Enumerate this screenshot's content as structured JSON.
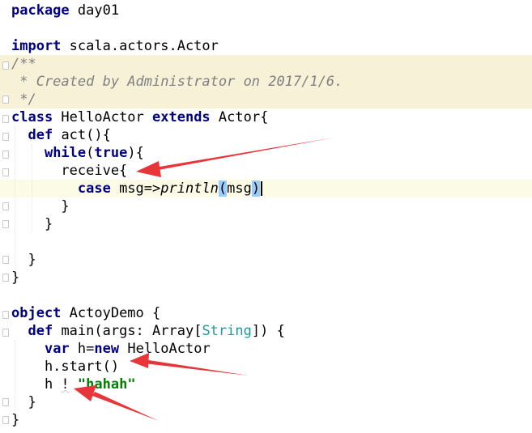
{
  "code_lines": [
    {
      "id": "l1",
      "segs": [
        {
          "t": "package",
          "c": "kw"
        },
        {
          "t": " day01"
        }
      ]
    },
    {
      "id": "l2",
      "segs": []
    },
    {
      "id": "l3",
      "segs": [
        {
          "t": "import",
          "c": "kw"
        },
        {
          "t": " scala.actors.Actor"
        }
      ]
    },
    {
      "id": "l4",
      "segs": [
        {
          "t": "/**",
          "c": "cm"
        }
      ]
    },
    {
      "id": "l5",
      "segs": [
        {
          "t": " * Created by Administrator on 2017/1/6.",
          "c": "cm"
        }
      ]
    },
    {
      "id": "l6",
      "segs": [
        {
          "t": " */",
          "c": "cm"
        }
      ]
    },
    {
      "id": "l7",
      "segs": [
        {
          "t": "class",
          "c": "kw"
        },
        {
          "t": " HelloActor "
        },
        {
          "t": "extends",
          "c": "kw"
        },
        {
          "t": " Actor{"
        }
      ]
    },
    {
      "id": "l8",
      "segs": [
        {
          "t": "  "
        },
        {
          "t": "def",
          "c": "kw"
        },
        {
          "t": " act(){"
        }
      ]
    },
    {
      "id": "l9",
      "segs": [
        {
          "t": "    "
        },
        {
          "t": "while",
          "c": "kw"
        },
        {
          "t": "("
        },
        {
          "t": "true",
          "c": "kw"
        },
        {
          "t": "){"
        }
      ]
    },
    {
      "id": "l10",
      "segs": [
        {
          "t": "      receive{"
        }
      ]
    },
    {
      "id": "l11",
      "segs": [
        {
          "t": "        "
        },
        {
          "t": "case",
          "c": "kw"
        },
        {
          "t": " msg=>"
        },
        {
          "t": "println",
          "c": "fn"
        },
        {
          "t": "(",
          "c": "paren-match"
        },
        {
          "t": "msg"
        },
        {
          "t": ")",
          "c": "paren-match"
        }
      ]
    },
    {
      "id": "l12",
      "segs": [
        {
          "t": "      }"
        }
      ]
    },
    {
      "id": "l13",
      "segs": [
        {
          "t": "    }"
        }
      ]
    },
    {
      "id": "l14",
      "segs": []
    },
    {
      "id": "l15",
      "segs": [
        {
          "t": "  }"
        }
      ]
    },
    {
      "id": "l16",
      "segs": [
        {
          "t": "}"
        }
      ]
    },
    {
      "id": "l17",
      "segs": []
    },
    {
      "id": "l18",
      "segs": [
        {
          "t": "object",
          "c": "kw"
        },
        {
          "t": " ActoyDemo {"
        }
      ]
    },
    {
      "id": "l19",
      "segs": [
        {
          "t": "  "
        },
        {
          "t": "def",
          "c": "kw"
        },
        {
          "t": " main(args: Array["
        },
        {
          "t": "String",
          "c": "type"
        },
        {
          "t": "]) {"
        }
      ]
    },
    {
      "id": "l20",
      "segs": [
        {
          "t": "    "
        },
        {
          "t": "var",
          "c": "kw"
        },
        {
          "t": " h="
        },
        {
          "t": "new",
          "c": "kw"
        },
        {
          "t": " HelloActor"
        }
      ]
    },
    {
      "id": "l21",
      "segs": [
        {
          "t": "    h.start()"
        }
      ]
    },
    {
      "id": "l22",
      "segs": [
        {
          "t": "    h "
        },
        {
          "t": "!",
          "c": "squiggle"
        },
        {
          "t": " "
        },
        {
          "t": "\"hahah\"",
          "c": "str"
        }
      ]
    },
    {
      "id": "l23",
      "segs": [
        {
          "t": "  }"
        }
      ]
    },
    {
      "id": "l24",
      "segs": [
        {
          "t": "}"
        }
      ]
    }
  ],
  "colors": {
    "keyword": "#000080",
    "comment": "#808080",
    "string": "#008000",
    "type": "#20999d",
    "doc_background": "#f7f1d8",
    "current_line_background": "#fbfbe6",
    "paren_match": "#99ccff",
    "annotation_arrow": "#e8353a"
  },
  "annotations": [
    {
      "name": "arrow-to-receive",
      "points_to": "receive{"
    },
    {
      "name": "arrow-to-start",
      "points_to": "h.start()"
    },
    {
      "name": "arrow-to-send",
      "points_to": "h ! \"hahah\""
    }
  ]
}
